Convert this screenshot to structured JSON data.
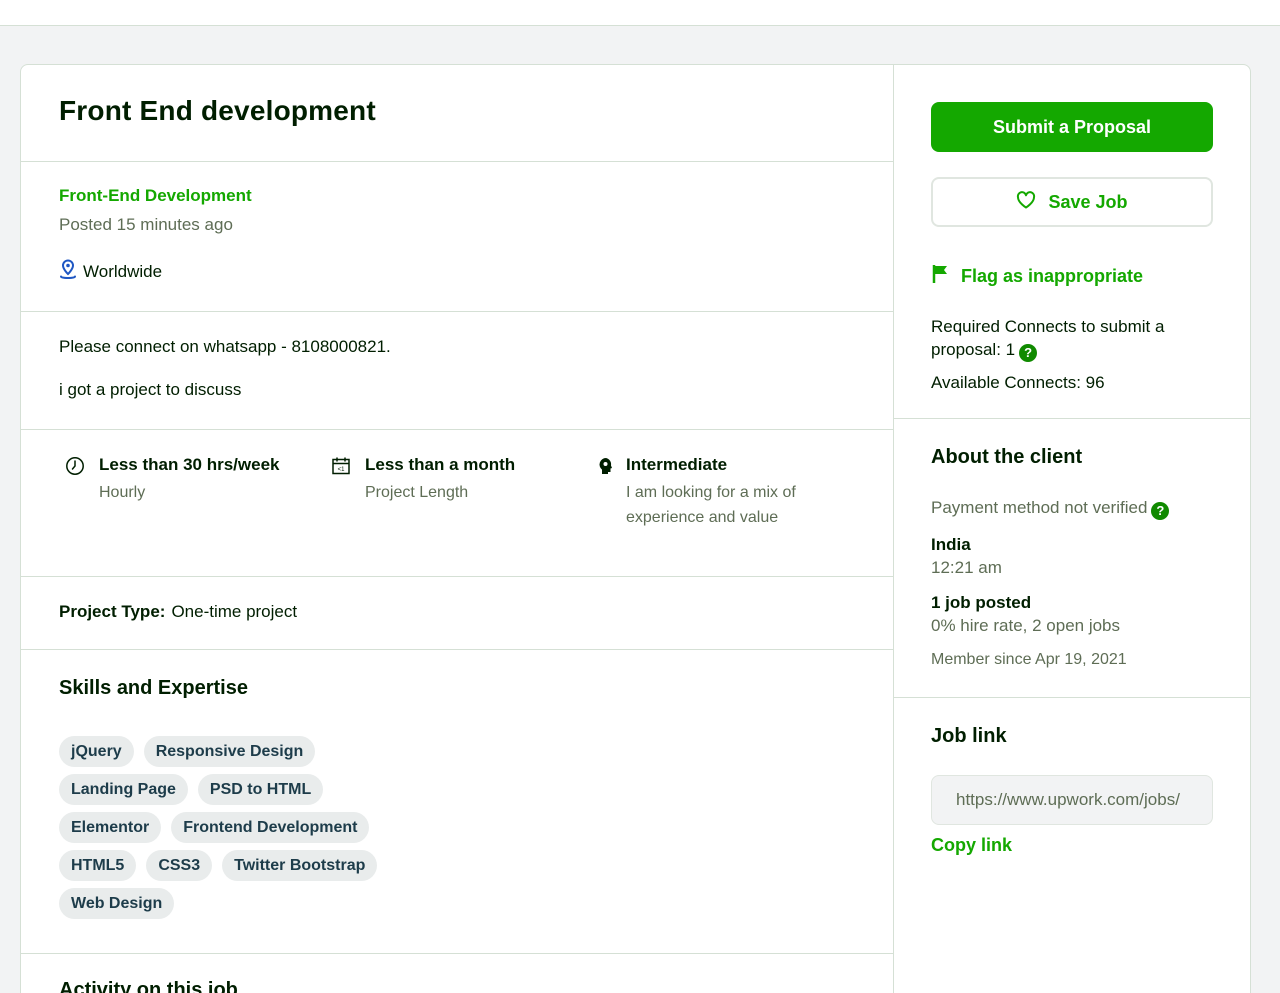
{
  "job": {
    "title": "Front End development",
    "category": "Front-End Development",
    "posted": "Posted 15 minutes ago",
    "location": "Worldwide",
    "description": [
      "Please connect on whatsapp - 8108000821.",
      "i got a project to discuss"
    ],
    "features": [
      {
        "icon": "clock-icon",
        "heading": "Less than 30 hrs/week",
        "sub": "Hourly"
      },
      {
        "icon": "calendar-icon",
        "heading": "Less than a month",
        "sub": "Project Length"
      },
      {
        "icon": "expertise-icon",
        "heading": "Intermediate",
        "sub": "I am looking for a mix of experience and value"
      }
    ],
    "project_type_label": "Project Type:",
    "project_type_value": "One-time project",
    "skills_heading": "Skills and Expertise",
    "skills": [
      "jQuery",
      "Responsive Design",
      "Landing Page",
      "PSD to HTML",
      "Elementor",
      "Frontend Development",
      "HTML5",
      "CSS3",
      "Twitter Bootstrap",
      "Web Design"
    ],
    "activity_heading": "Activity on this job"
  },
  "sidebar": {
    "submit_label": "Submit a Proposal",
    "save_label": "Save Job",
    "flag_label": "Flag as inappropriate",
    "connects_required": "Required Connects to submit a proposal: 1",
    "connects_available": "Available Connects: 96",
    "help_glyph": "?",
    "client": {
      "heading": "About the client",
      "payment": "Payment method not verified",
      "country": "India",
      "time": "12:21 am",
      "jobs_posted": "1 job posted",
      "hire_rate": "0% hire rate, 2 open jobs",
      "member_since": "Member since Apr 19, 2021"
    },
    "job_link": {
      "heading": "Job link",
      "url": "https://www.upwork.com/jobs/",
      "copy_label": "Copy link"
    }
  },
  "colors": {
    "brand_green": "#14a800",
    "text_dark": "#001e00",
    "text_muted": "#5e6d55",
    "chip_bg": "#e9ecec",
    "location_blue": "#1f57c3"
  }
}
